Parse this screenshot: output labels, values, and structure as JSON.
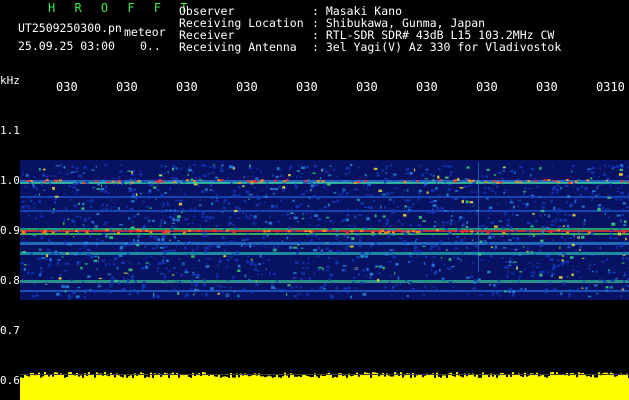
{
  "header": {
    "app_name": "H R O F F T",
    "filename": "UT2509250300.pn",
    "type_label": "meteor",
    "datetime": "25.09.25 03:00",
    "count": "0..",
    "observer_label": "Observer",
    "observer_value": ": Masaki Kano",
    "location_label": "Receiving Location",
    "location_value": ": Shibukawa, Gunma, Japan",
    "receiver_label": "Receiver",
    "receiver_value": ": RTL-SDR SDR# 43dB L15 103.2MHz CW",
    "antenna_label": "Receiving Antenna",
    "antenna_value": ": 3el Yagi(V) Az 330 for Vladivostok"
  },
  "y_axis": {
    "unit": "kHz",
    "ticks": [
      "1.1",
      "1.0",
      "0.9",
      "0.8",
      "0.7",
      "0.6"
    ]
  },
  "x_axis": {
    "ticks": [
      "030",
      "030",
      "030",
      "030",
      "030",
      "030",
      "030",
      "030",
      "030",
      "0310"
    ]
  },
  "colors": {
    "background": "#000000",
    "header_green": "#3ee64a",
    "signal_band": "#ffff00",
    "noise_blue": "#1030c8"
  }
}
